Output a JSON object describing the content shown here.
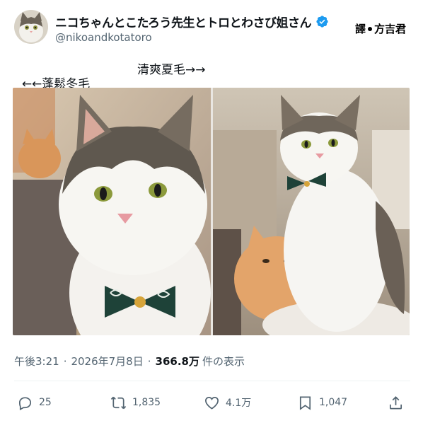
{
  "author": {
    "display_name": "ニコちゃんとこたろう先生とトロとわさび姐さん",
    "handle": "@nikoandkotatoro",
    "verified_color": "#1d9bf0"
  },
  "stamp": {
    "left": "譯",
    "right": "方吉君"
  },
  "tweet": {
    "left_text": "←←蓬鬆冬毛",
    "right_text": "清爽夏毛→→"
  },
  "meta": {
    "time": "午後3:21",
    "sep": "·",
    "date": "2026年7月8日",
    "views_count": "366.8万",
    "views_label": "件の表示"
  },
  "actions": {
    "reply_count": "25",
    "repost_count": "1,835",
    "like_count": "4.1万",
    "bookmark_count": "1,047"
  }
}
